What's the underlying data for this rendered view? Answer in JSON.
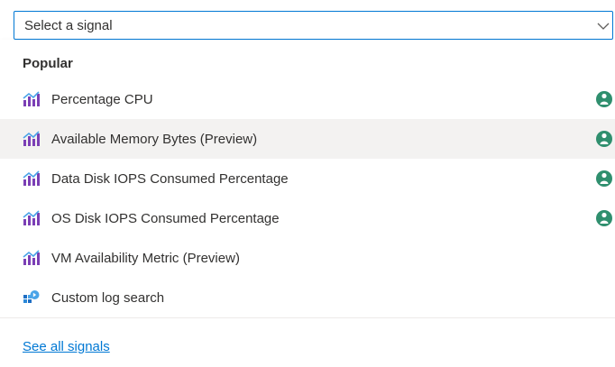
{
  "signal_select": {
    "placeholder": "Select a signal"
  },
  "dropdown": {
    "group_header": "Popular",
    "items": [
      {
        "label": "Percentage CPU",
        "icon": "metric-chart-icon",
        "recommended": true
      },
      {
        "label": "Available Memory Bytes (Preview)",
        "icon": "metric-chart-icon",
        "recommended": true
      },
      {
        "label": "Data Disk IOPS Consumed Percentage",
        "icon": "metric-chart-icon",
        "recommended": true
      },
      {
        "label": "OS Disk IOPS Consumed Percentage",
        "icon": "metric-chart-icon",
        "recommended": true
      },
      {
        "label": "VM Availability Metric (Preview)",
        "icon": "metric-chart-icon",
        "recommended": false
      },
      {
        "label": "Custom log search",
        "icon": "log-search-icon",
        "recommended": false
      }
    ],
    "see_all_link": "See all signals"
  },
  "colors": {
    "accent": "#0078d4",
    "hover_bg": "#f3f2f1",
    "badge": "#2f8f6e",
    "metric_purple": "#7b3fb5",
    "metric_blue": "#4aa4e8"
  }
}
